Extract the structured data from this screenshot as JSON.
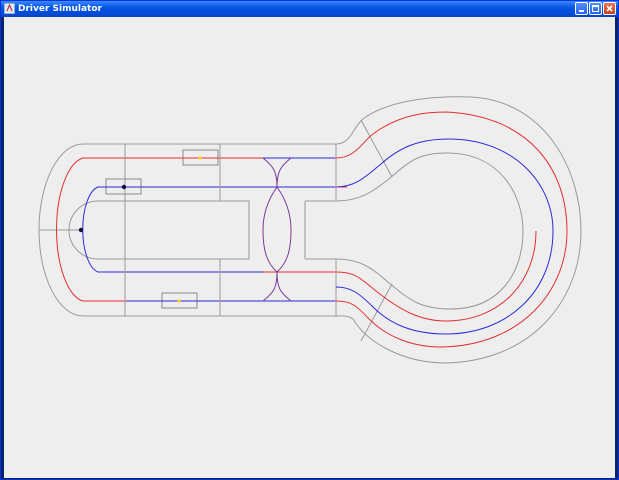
{
  "window": {
    "title": "Driver Simulator",
    "controls": {
      "minimize_icon": "minimize-icon",
      "maximize_icon": "maximize-icon",
      "close_icon": "close-icon"
    }
  },
  "track": {
    "colors": {
      "background": "#eeeeee",
      "outline": "#9a9a9a",
      "lane_red": "#e23030",
      "lane_blue": "#2a2ad8",
      "switch_purple": "#7a3a9a",
      "car_marker": "#101040",
      "sensor_dot": "#ffd21f"
    }
  }
}
